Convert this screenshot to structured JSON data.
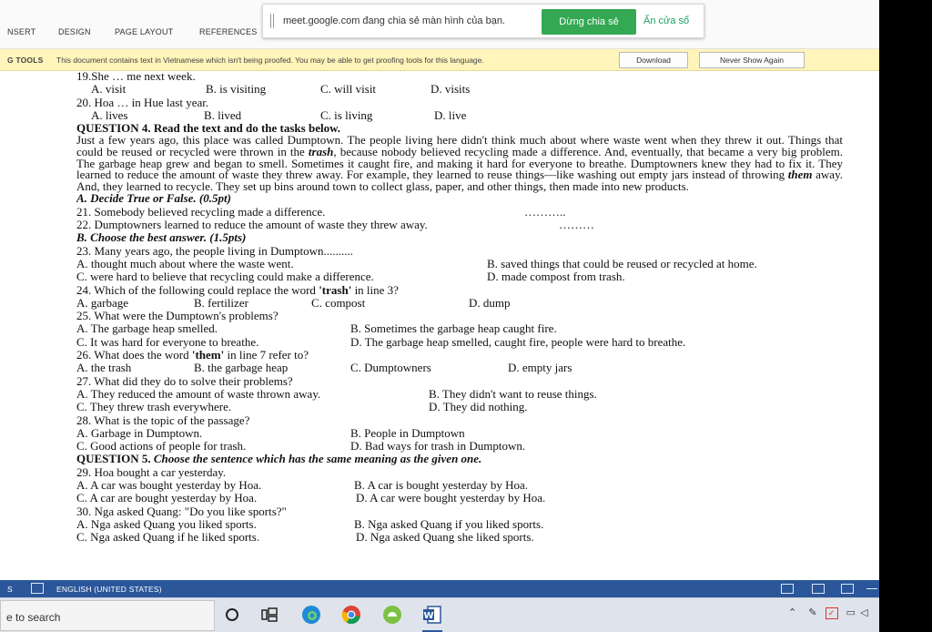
{
  "ribbon": {
    "tabs": [
      "NSERT",
      "DESIGN",
      "PAGE LAYOUT",
      "REFERENCES"
    ]
  },
  "share_bar": {
    "message": "meet.google.com đang chia sẻ màn hình của bạn.",
    "stop_label": "Dừng chia sẻ",
    "hide_label": "Ẩn cửa sổ",
    "accent": "#34a853"
  },
  "message_bar": {
    "title": "G TOOLS",
    "text": "This document contains text in Vietnamese which isn't being proofed. You may be able to get proofing tools for this language.",
    "download_label": "Download",
    "never_show_label": "Never Show Again",
    "background": "#fff4ba"
  },
  "document": {
    "q19": {
      "stem": "19.She … me next week.",
      "a": "A. visit",
      "b": "B. is visiting",
      "c": "C. will visit",
      "d": "D. visits"
    },
    "q20": {
      "stem": "20. Hoa … in Hue last year.",
      "a": "A. lives",
      "b": "B. lived",
      "c": "C. is living",
      "d": "D. live"
    },
    "q4_heading": "QUESTION 4. Read the text and do the tasks below.",
    "passage": {
      "p1": "Just a few years ago, this place was called Dumptown. The people living here didn't think much about where waste went when they threw it out. Things that could be reused or recycled were thrown in the ",
      "trash": "trash",
      "p2": ", because nobody believed recycling made a difference. And, eventually, that became a very big problem. The garbage heap grew and began to smell. Sometimes it caught fire, and making it hard for everyone to breathe. Dumptowners knew they had to fix it. They learned to reduce the amount of waste they threw away. For example, they learned to reuse things—like washing out empty jars instead of throwing ",
      "them": "them",
      "p3": " away. And, they learned to recycle. They set up bins around town to collect glass, paper, and other things, then made into new products."
    },
    "part_a": "A. Decide True or False. (0.5pt)",
    "q21": {
      "text": "21. Somebody believed recycling made a difference.",
      "blank": "……….."
    },
    "q22": {
      "text": "22. Dumptowners learned to reduce the amount of waste they threw away.",
      "blank": "………"
    },
    "part_b": "B. Choose the best answer. (1.5pts)",
    "q23": {
      "stem": "23. Many years ago, the people living in Dumptown..........",
      "a": "A. thought much about where the waste went.",
      "b": "B. saved things that could be reused or recycled at home.",
      "c": "C. were hard to believe that recycling could make a difference.",
      "d": "D. made compost from trash."
    },
    "q24": {
      "stem_pre": "24. Which of the following could replace the word ",
      "stem_word": "'trash'",
      "stem_post": " in line 3?",
      "a": "A. garbage",
      "b": "B. fertilizer",
      "c": "C. compost",
      "d": "D. dump"
    },
    "q25": {
      "stem": "25. What were the Dumptown's problems?",
      "a": "A. The garbage heap smelled.",
      "b": "B. Sometimes the garbage heap caught fire.",
      "c": "C. It was hard for everyone to breathe.",
      "d": "D. The garbage heap smelled, caught fire, people were hard to breathe."
    },
    "q26": {
      "stem_pre": "26. What does the word ",
      "stem_word": "'them'",
      "stem_post": " in line 7 refer to?",
      "a": "A. the trash",
      "b": "B. the garbage heap",
      "c": "C. Dumptowners",
      "d": "D. empty jars"
    },
    "q27": {
      "stem": "27. What did they do to solve their problems?",
      "a": "A. They reduced the amount of waste thrown away.",
      "b": "B. They didn't want to reuse things.",
      "c": "C. They threw trash everywhere.",
      "d": "D. They did nothing."
    },
    "q28": {
      "stem": "28. What is the topic of the passage?",
      "a": "A. Garbage in Dumptown.",
      "b": "B. People in Dumptown",
      "c": "C. Good actions of people for trash.",
      "d": "D. Bad ways for trash in Dumptown."
    },
    "q5_heading_pre": "QUESTION 5. ",
    "q5_heading_em": "Choose the sentence which has the same meaning as the given one.",
    "q29": {
      "stem": "29. Hoa bought a car yesterday.",
      "a": "A. A car was bought yesterday by Hoa.",
      "b": "B. A car is bought yesterday by Hoa.",
      "c": "C. A car are bought yesterday by Hoa.",
      "d": "D. A car were bought yesterday by Hoa."
    },
    "q30": {
      "stem": "30. Nga asked Quang: \"Do you like sports?\"",
      "a": "A. Nga asked Quang you liked sports.",
      "b": "B. Nga asked Quang if you liked sports.",
      "c": "C. Nga asked Quang if he liked sports.",
      "d": "D. Nga asked Quang she liked sports."
    }
  },
  "status_bar": {
    "page": "S",
    "language": "ENGLISH (UNITED STATES)",
    "background": "#2b579a"
  },
  "taskbar": {
    "search_placeholder": "e to search",
    "icons": [
      "cortana-icon",
      "task-view-icon",
      "edge-icon",
      "chrome-icon",
      "android-icon",
      "word-icon"
    ]
  }
}
